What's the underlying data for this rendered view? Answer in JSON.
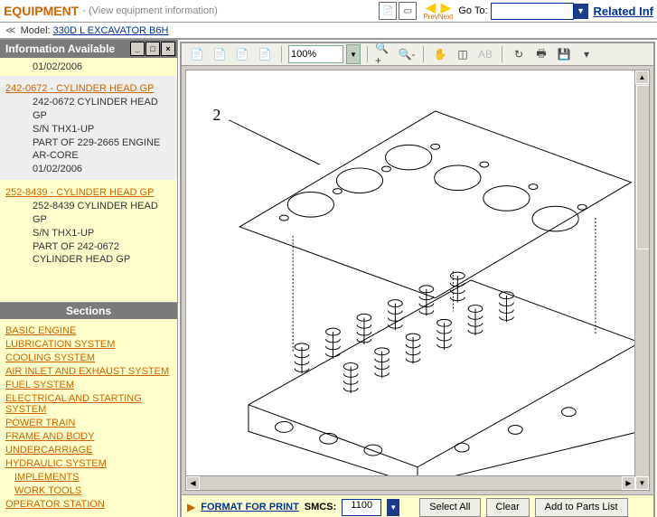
{
  "header": {
    "title": "EQUIPMENT",
    "subtitle": "- (View equipment information)",
    "model_label": "Model:",
    "model_value": "330D L EXCAVATOR B6H",
    "goto_label": "Go To:",
    "related": "Related Inf",
    "prev": "Prev",
    "next": "Next"
  },
  "sidebar": {
    "title": "Information Available",
    "top_date": "01/02/2006",
    "items": [
      {
        "header": "242-0672 - CYLINDER HEAD GP",
        "selected": true,
        "lines": [
          "242-0672 CYLINDER HEAD GP",
          "S/N THX1-UP",
          "PART OF 229-2665 ENGINE AR-CORE",
          "01/02/2006"
        ]
      },
      {
        "header": "252-8439 - CYLINDER HEAD GP",
        "selected": false,
        "lines": [
          "252-8439 CYLINDER HEAD GP",
          "S/N THX1-UP",
          "PART OF 242-0672 CYLINDER HEAD GP"
        ]
      }
    ]
  },
  "sections": {
    "title": "Sections",
    "links": [
      "BASIC ENGINE",
      "LUBRICATION SYSTEM",
      "COOLING SYSTEM",
      "AIR INLET AND EXHAUST SYSTEM",
      "FUEL SYSTEM",
      "ELECTRICAL AND STARTING SYSTEM",
      "POWER TRAIN",
      "FRAME AND BODY",
      "UNDERCARRIAGE",
      "HYDRAULIC SYSTEM",
      "IMPLEMENTS",
      "WORK TOOLS",
      "OPERATOR STATION"
    ],
    "indent_last_two": true
  },
  "toolbar": {
    "zoom": "100%"
  },
  "viewer": {
    "callout": "2"
  },
  "footer": {
    "format_label": "FORMAT FOR PRINT",
    "smcs_label": "SMCS:",
    "smcs_value": "1100",
    "select_all": "Select All",
    "clear": "Clear",
    "add": "Add to Parts List"
  }
}
